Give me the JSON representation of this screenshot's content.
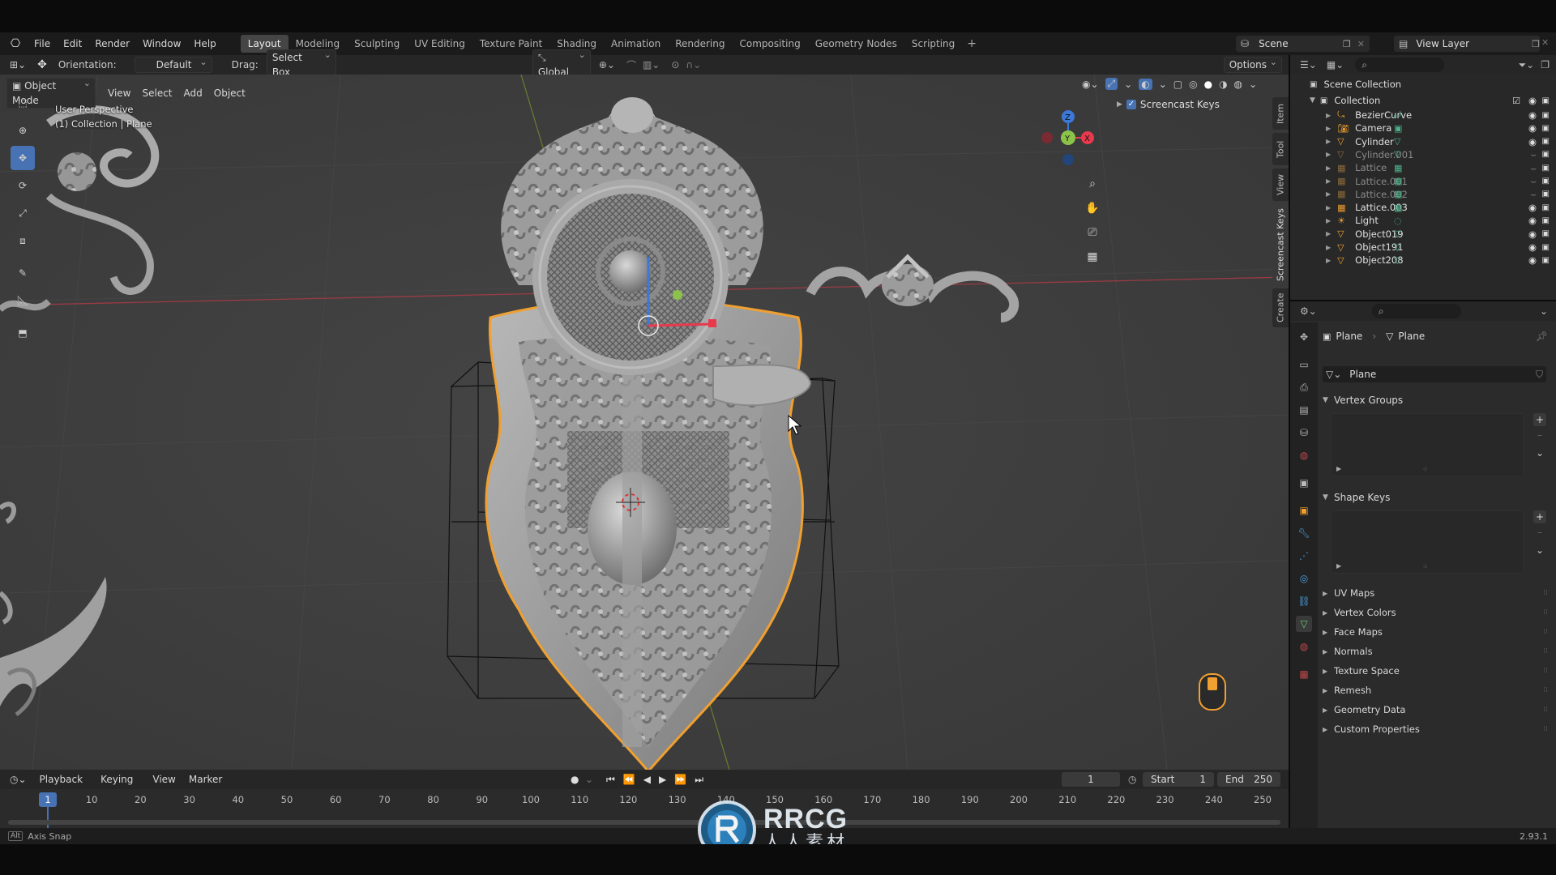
{
  "topbar": {
    "menus": [
      "File",
      "Edit",
      "Render",
      "Window",
      "Help"
    ],
    "workspaces": [
      "Layout",
      "Modeling",
      "Sculpting",
      "UV Editing",
      "Texture Paint",
      "Shading",
      "Animation",
      "Rendering",
      "Compositing",
      "Geometry Nodes",
      "Scripting"
    ],
    "active_workspace": "Layout",
    "add_tab": "+",
    "scene_name": "Scene",
    "view_layer": "View Layer"
  },
  "tool_header": {
    "orientation_label": "Orientation:",
    "orientation_value": "Default",
    "drag_label": "Drag:",
    "drag_value": "Select Box",
    "transform_orientation": "Global",
    "options": "Options"
  },
  "viewport_header": {
    "mode": "Object Mode",
    "menus": [
      "View",
      "Select",
      "Add",
      "Object"
    ]
  },
  "viewport": {
    "perspective": "User Perspective",
    "collection_info": "(1) Collection | Plane",
    "screencast_keys_label": "Screencast Keys",
    "screencast_keys_checked": true,
    "side_tabs": [
      "Item",
      "Tool",
      "View",
      "Screencast Keys",
      "Create"
    ],
    "gizmo_axes": [
      "Z",
      "X",
      "Y"
    ],
    "accent_colors": {
      "x": "#e8394d",
      "y": "#8bc34a",
      "z": "#3b79d8",
      "selection": "#f0a030"
    }
  },
  "outliner": {
    "root": "Scene Collection",
    "collection": "Collection",
    "items": [
      {
        "name": "BezierCurve",
        "icon": "curve-icon",
        "dim": false
      },
      {
        "name": "Camera",
        "icon": "camera-icon",
        "dim": false
      },
      {
        "name": "Cylinder",
        "icon": "mesh-icon",
        "dim": false
      },
      {
        "name": "Cylinder.001",
        "icon": "mesh-icon",
        "dim": true
      },
      {
        "name": "Lattice",
        "icon": "lattice-icon",
        "dim": true
      },
      {
        "name": "Lattice.001",
        "icon": "lattice-icon",
        "dim": true
      },
      {
        "name": "Lattice.002",
        "icon": "lattice-icon",
        "dim": true
      },
      {
        "name": "Lattice.003",
        "icon": "lattice-icon",
        "dim": false
      },
      {
        "name": "Light",
        "icon": "light-icon",
        "dim": false
      },
      {
        "name": "Object019",
        "icon": "mesh-icon",
        "dim": false
      },
      {
        "name": "Object191",
        "icon": "mesh-icon",
        "dim": false
      },
      {
        "name": "Object208",
        "icon": "mesh-icon",
        "dim": false
      }
    ]
  },
  "properties": {
    "breadcrumb_object": "Plane",
    "breadcrumb_data": "Plane",
    "mesh_name": "Plane",
    "vertex_groups": "Vertex Groups",
    "shape_keys": "Shape Keys",
    "collapsed_panels": [
      "UV Maps",
      "Vertex Colors",
      "Face Maps",
      "Normals",
      "Texture Space",
      "Remesh",
      "Geometry Data",
      "Custom Properties"
    ]
  },
  "timeline": {
    "menus": [
      "Playback",
      "Keying",
      "View",
      "Marker"
    ],
    "current_frame": "1",
    "start_label": "Start",
    "start": "1",
    "end_label": "End",
    "end": "250",
    "ruler": [
      "1",
      "10",
      "20",
      "30",
      "40",
      "50",
      "60",
      "70",
      "80",
      "90",
      "100",
      "110",
      "120",
      "130",
      "140",
      "150",
      "160",
      "170",
      "180",
      "190",
      "200",
      "210",
      "220",
      "230",
      "240",
      "250"
    ],
    "playhead": "1"
  },
  "statusbar": {
    "hint": "Axis Snap",
    "version": "2.93.1"
  },
  "watermark": {
    "brand": "RRCG",
    "sub": "人人素材"
  }
}
